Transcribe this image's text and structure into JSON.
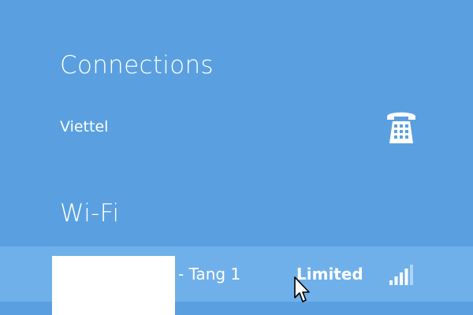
{
  "connections": {
    "title": "Connections",
    "mobile": {
      "name": "Viettel",
      "icon": "phone-icon"
    }
  },
  "wifi": {
    "title": "Wi-Fi",
    "network": {
      "name_suffix": "- Tang 1",
      "status": "Limited",
      "icon": "wifi-signal-icon",
      "signal_bars": 4,
      "signal_bars_total": 5
    }
  },
  "colors": {
    "panel_bg": "#5aa0e1",
    "selected_row_bg": "#6fb0ea",
    "text": "#ffffff"
  }
}
